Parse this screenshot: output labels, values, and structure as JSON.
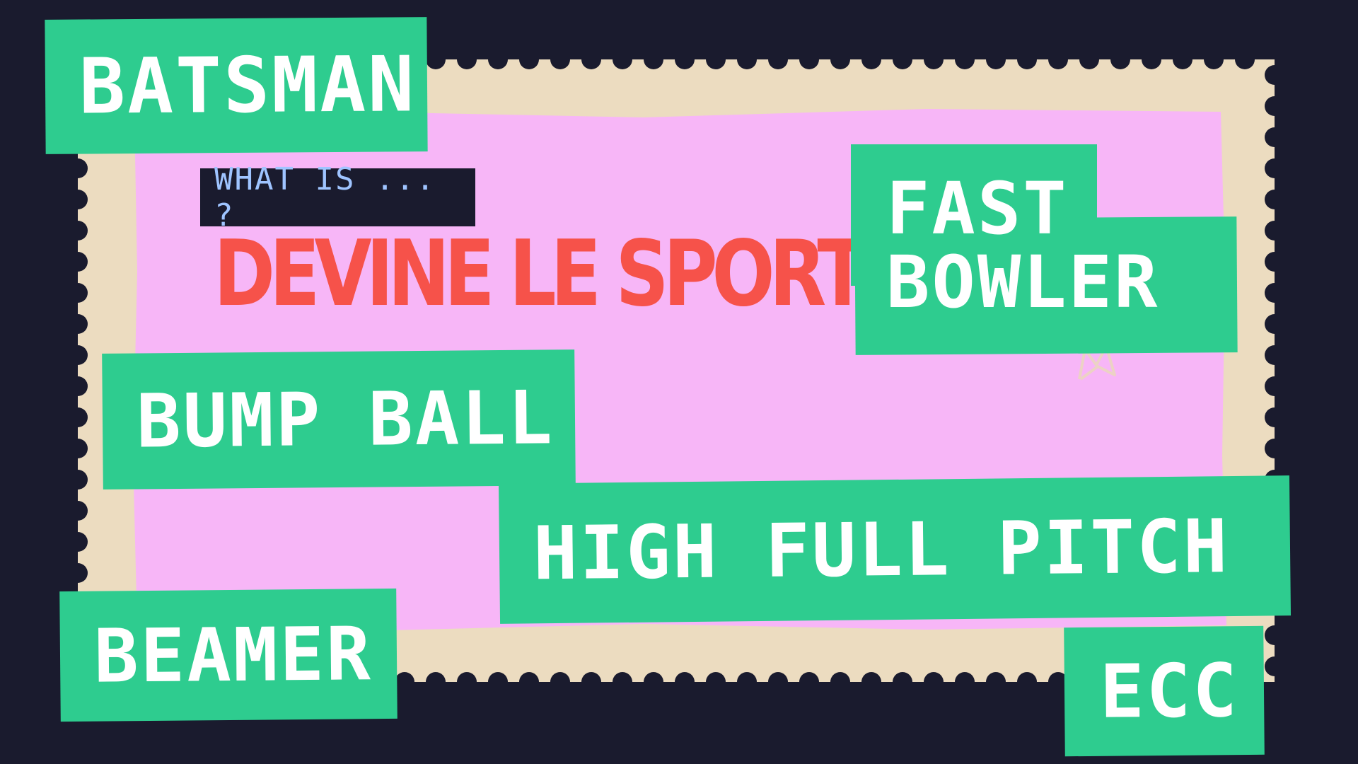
{
  "header": {
    "question": "WHAT IS ... ?",
    "title": "DEVINE LE SPORT"
  },
  "terms": {
    "batsman": "BATSMAN",
    "fast_line1": "FAST",
    "fast_line2": "BOWLER",
    "bump_ball": "BUMP BALL",
    "high_full_pitch": "HIGH FULL PITCH",
    "beamer": "BEAMER",
    "ecc": "ECC"
  },
  "colors": {
    "background": "#1a1b2e",
    "stamp_border": "#ecdcc0",
    "stamp_inner": "#f7b6f7",
    "tag": "#2ecc8f",
    "title": "#f6524a",
    "question": "#9fc4ff"
  }
}
